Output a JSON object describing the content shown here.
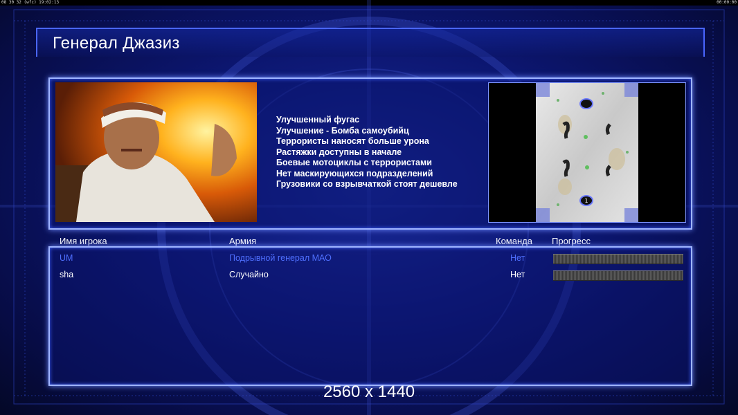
{
  "overlay": {
    "left": "08 30 32 (wfc) 19:02:13",
    "right": "00:00:00"
  },
  "title": "Генерал Джазиз",
  "features": [
    "Улучшенный фугас",
    "Улучшение - Бомба самоубийц",
    "Террористы наносят больше урона",
    "Растяжки доступны в начале",
    "Боевые мотоциклы с террористами",
    "Нет маскирующихся подразделений",
    "Грузовики со взрывчаткой стоят дешевле"
  ],
  "map": {
    "start_marker": "1"
  },
  "columns": {
    "player": "Имя игрока",
    "army": "Армия",
    "team": "Команда",
    "progress": "Прогресс"
  },
  "players": [
    {
      "name": "UM",
      "army": "Подрывной генерал МАО",
      "team": "Нет",
      "color": "#4f6fff"
    },
    {
      "name": "sha",
      "army": "Случайно",
      "team": "Нет",
      "color": "#ffffff"
    }
  ],
  "resolution": "2560 x 1440",
  "colors": {
    "accent": "#9fb4ff",
    "background": "#0c1670",
    "highlight_player": "#4f6fff"
  }
}
